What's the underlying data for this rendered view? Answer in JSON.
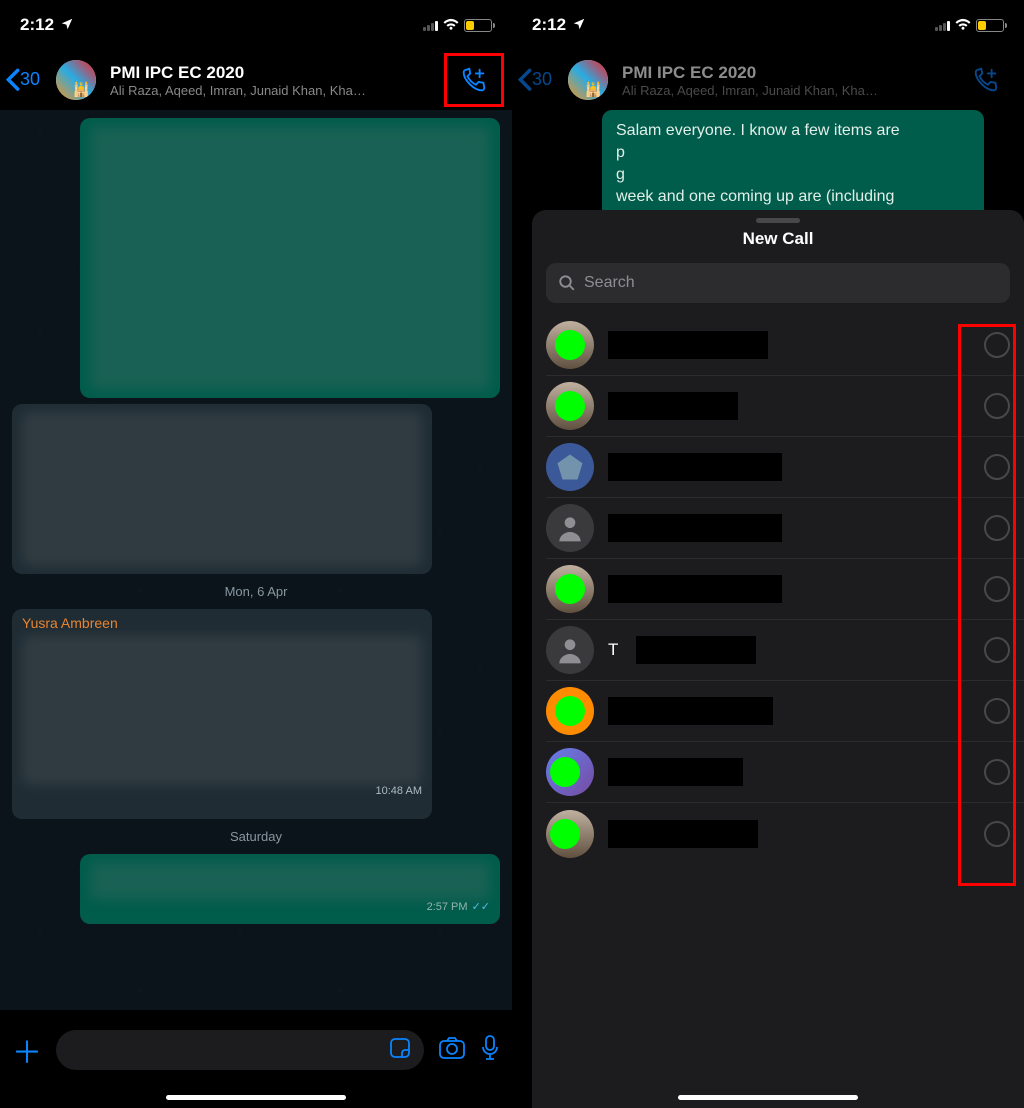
{
  "status": {
    "time": "2:12",
    "location_arrow": "➤"
  },
  "header": {
    "back_count": "30",
    "title": "PMI IPC EC 2020",
    "subtitle": "Ali Raza, Aqeed, Imran, Junaid Khan, Kha…"
  },
  "chat": {
    "date1": "Mon, 6 Apr",
    "date2": "Saturday",
    "sender_name": "Yusra Ambreen",
    "time_in": "10:48 AM",
    "time_out": "2:57 PM"
  },
  "behind_msg": {
    "line1": "Salam everyone. I know a few items are",
    "line2": "p",
    "line3": "g",
    "line4": "week and one coming up are (including"
  },
  "sheet": {
    "title": "New Call",
    "search_placeholder": "Search",
    "contacts": [
      {
        "id": "c1",
        "avatar": "green-photo"
      },
      {
        "id": "c2",
        "avatar": "green-photo"
      },
      {
        "id": "c3",
        "avatar": "blue"
      },
      {
        "id": "c4",
        "avatar": "generic"
      },
      {
        "id": "c5",
        "avatar": "green-photo"
      },
      {
        "id": "c6",
        "avatar": "generic",
        "initial": "T"
      },
      {
        "id": "c7",
        "avatar": "orange-green"
      },
      {
        "id": "c8",
        "avatar": "photo-green"
      },
      {
        "id": "c9",
        "avatar": "photo-green"
      }
    ]
  }
}
